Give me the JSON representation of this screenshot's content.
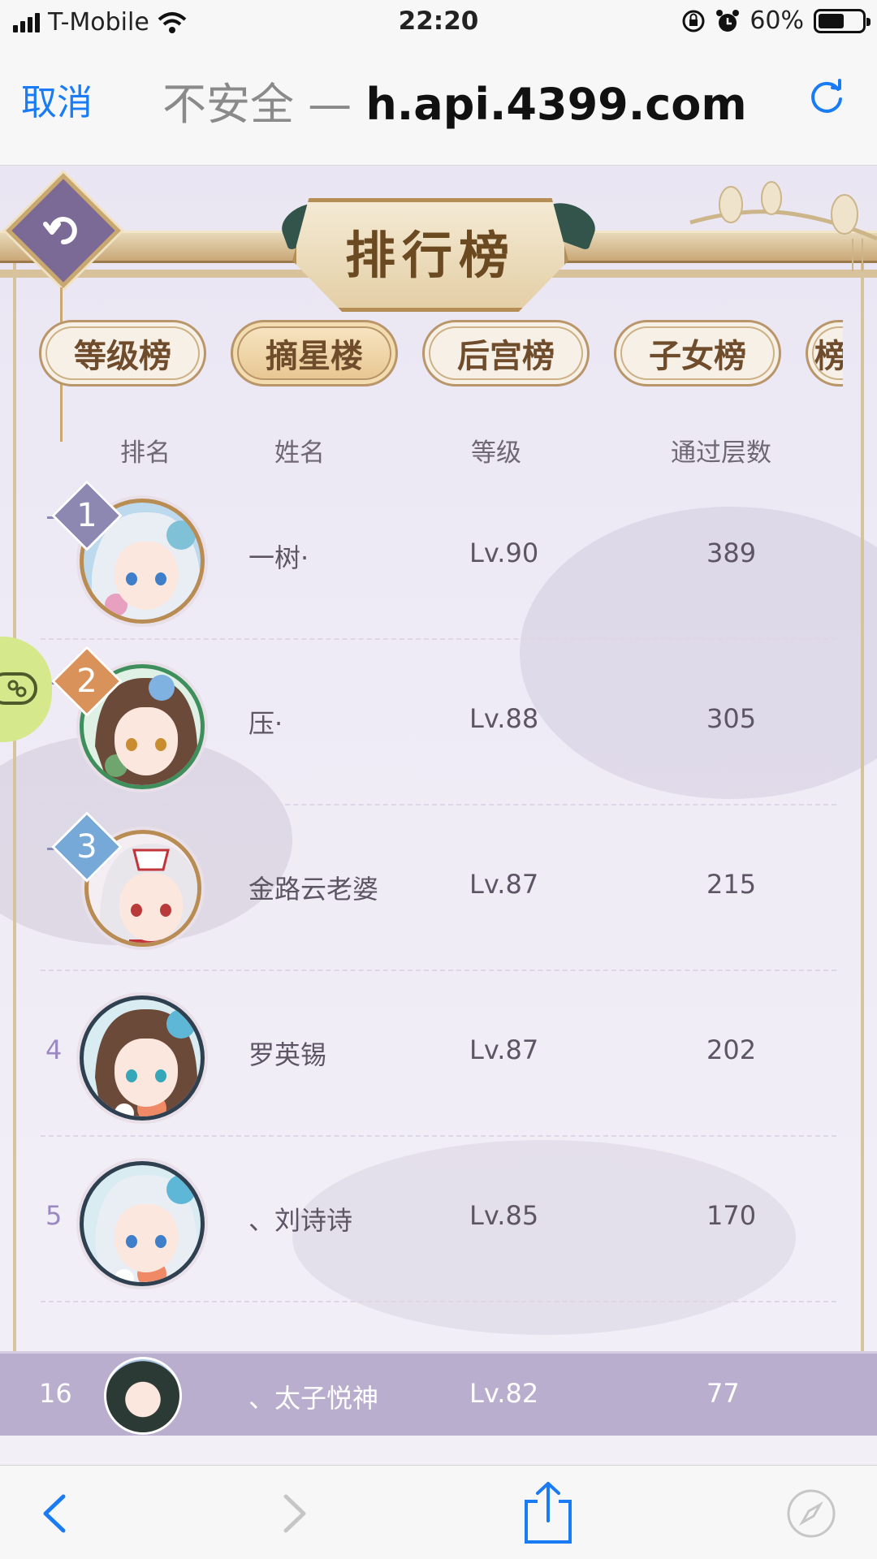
{
  "status_bar": {
    "carrier": "T-Mobile",
    "time": "22:20",
    "battery": "60%",
    "battery_level": 0.6
  },
  "browser": {
    "cancel_label": "取消",
    "insecure_label": "不安全 —",
    "host": "h.api.4399.com"
  },
  "page": {
    "title": "排行榜",
    "tabs": [
      {
        "label": "等级榜",
        "active": false
      },
      {
        "label": "摘星楼",
        "active": true
      },
      {
        "label": "后宫榜",
        "active": false
      },
      {
        "label": "子女榜",
        "active": false
      },
      {
        "label": "榜",
        "active": false,
        "partial": true
      }
    ],
    "columns": {
      "rank": "排名",
      "name": "姓名",
      "level": "等级",
      "floors": "通过层数"
    },
    "rows": [
      {
        "rank": "1",
        "name": "一树·",
        "level": "Lv.90",
        "floors": "389",
        "badge_color": "#8c88b2"
      },
      {
        "rank": "2",
        "name": "压·",
        "level": "Lv.88",
        "floors": "305",
        "badge_color": "#d9935a"
      },
      {
        "rank": "3",
        "name": "金路云老婆",
        "level": "Lv.87",
        "floors": "215",
        "badge_color": "#76a8d8"
      },
      {
        "rank": "4",
        "name": "罗英锡",
        "level": "Lv.87",
        "floors": "202"
      },
      {
        "rank": "5",
        "name": "、刘诗诗",
        "level": "Lv.85",
        "floors": "170"
      }
    ],
    "my_row": {
      "rank": "16",
      "name": "、太子悦神",
      "level": "Lv.82",
      "floors": "77"
    }
  },
  "colors": {
    "ios_blue": "#1a7cf4",
    "frame_gold": "#b88c52",
    "row_highlight": "#baaece"
  },
  "icons": [
    "signal-icon",
    "wifi-icon",
    "lock-rotation-icon",
    "alarm-icon",
    "battery-icon",
    "reload-icon",
    "back-icon",
    "forward-icon",
    "share-icon",
    "compass-icon",
    "game-controller-icon"
  ]
}
